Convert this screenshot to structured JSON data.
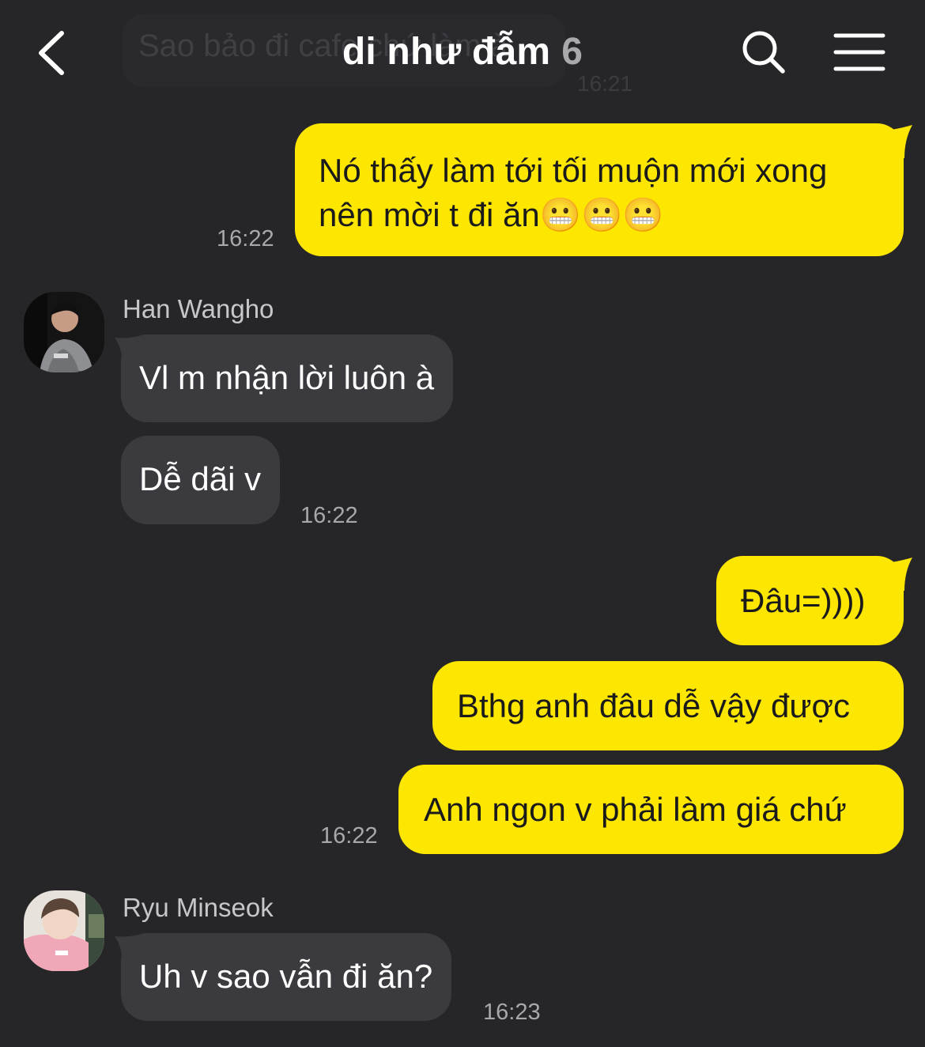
{
  "header": {
    "title": "di như đẫm",
    "member_count": "6",
    "ghost_preview_text": "Sao bảo đi cafe chứ làm à",
    "ghost_preview_time": "16:21"
  },
  "messages": [
    {
      "side": "mine",
      "lines": [
        "Nó thấy làm tới tối muộn mới xong",
        "nên mời t đi ăn😬😬😬"
      ],
      "time": "16:22"
    },
    {
      "side": "theirs",
      "sender": "Han Wangho",
      "text": "Vl m nhận lời luôn à"
    },
    {
      "side": "theirs",
      "text": "Dễ dãi v",
      "time": "16:22"
    },
    {
      "side": "mine",
      "text": "Đâu=))))"
    },
    {
      "side": "mine",
      "text": "Bthg anh đâu dễ vậy được"
    },
    {
      "side": "mine",
      "text": "Anh ngon v phải làm giá chứ",
      "time": "16:22"
    },
    {
      "side": "theirs",
      "sender": "Ryu Minseok",
      "text": "Uh v sao vẫn đi ăn?",
      "time": "16:23"
    }
  ],
  "colors": {
    "background": "#262629",
    "my_bubble": "#fde600",
    "their_bubble": "#3b3b3f",
    "timestamp": "#a8a8ac"
  },
  "icons": {
    "back": "chevron-left-icon",
    "search": "search-icon",
    "menu": "hamburger-menu-icon"
  }
}
